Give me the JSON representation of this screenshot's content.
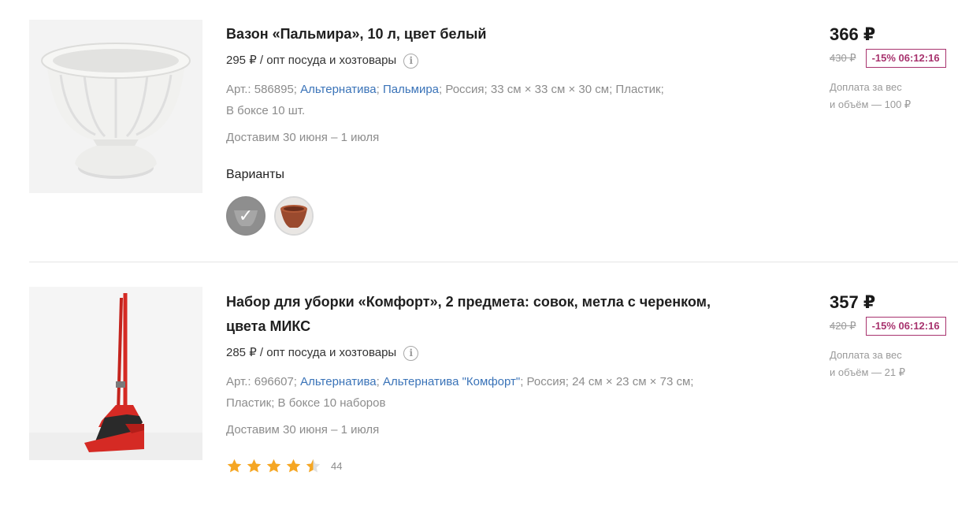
{
  "products": [
    {
      "title": "Вазон «Пальмира», 10 л, цвет белый",
      "wholesale": "295 ₽ / опт посуда и хозтовары",
      "meta": {
        "article": "Арт.: 586895;",
        "brand": "Альтернатива",
        "sep1": ";",
        "series": "Пальмира",
        "rest": "; Россия; 33 см × 33 см × 30 см; Пластик;",
        "rest2": "В боксе 10 шт."
      },
      "delivery": "Доставим 30 июня – 1 июля",
      "variants_label": "Варианты",
      "price": "366 ₽",
      "old_price": "430 ₽",
      "discount": "-15% 06:12:16",
      "surcharge_1": "Доплата за вес",
      "surcharge_2": "и объём — 100 ₽"
    },
    {
      "title": "Набор для уборки «Комфорт», 2 предмета: совок, метла с черенком, цвета МИКС",
      "wholesale": "285 ₽ / опт посуда и хозтовары",
      "meta": {
        "article": "Арт.: 696607;",
        "brand": "Альтернатива",
        "sep1": ";",
        "series": "Альтернатива \"Комфорт\"",
        "rest": "; Россия; 24 см × 23 см × 73 см;",
        "rest2": "Пластик; В боксе 10 наборов"
      },
      "delivery": "Доставим 30 июня – 1 июля",
      "rating_value": 4.5,
      "rating_count": "44",
      "price": "357 ₽",
      "old_price": "420 ₽",
      "discount": "-15% 06:12:16",
      "surcharge_1": "Доплата за вес",
      "surcharge_2": "и объём — 21 ₽"
    }
  ],
  "colors": {
    "link": "#3a73b8",
    "discount": "#a8336e",
    "star": "#f5a623"
  }
}
